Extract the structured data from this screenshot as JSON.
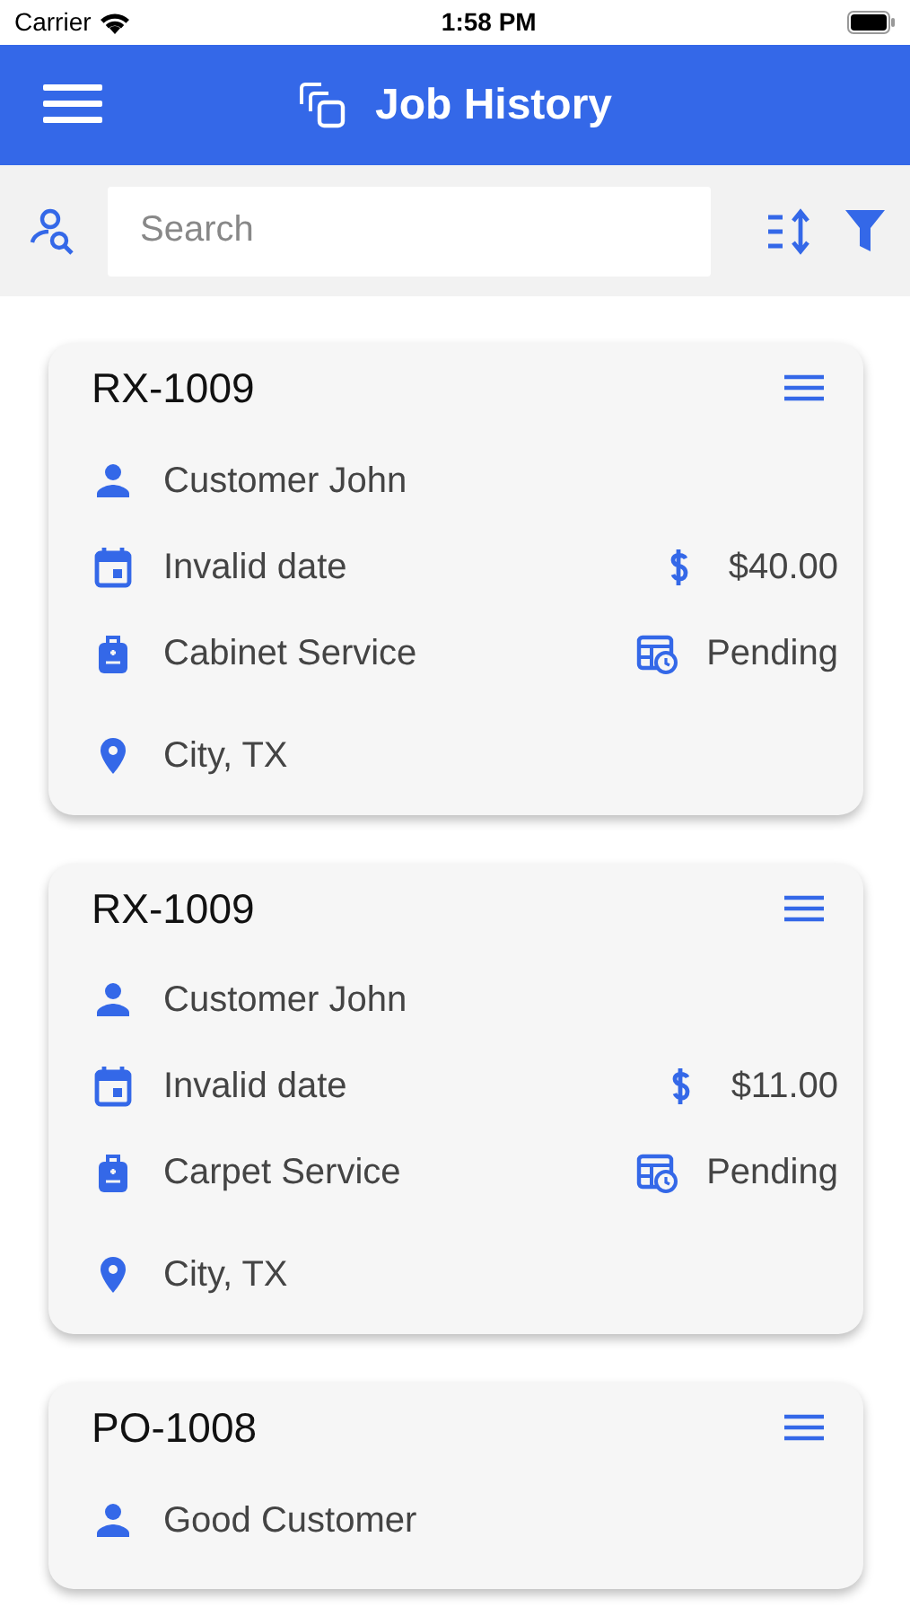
{
  "status_bar": {
    "carrier": "Carrier",
    "time": "1:58 PM"
  },
  "header": {
    "title": "Job History"
  },
  "search": {
    "placeholder": "Search"
  },
  "jobs": [
    {
      "id": "RX-1009",
      "customer": "Customer John",
      "date": "Invalid date",
      "amount": "$40.00",
      "service": "Cabinet Service",
      "status": "Pending",
      "location": "City, TX"
    },
    {
      "id": "RX-1009",
      "customer": "Customer John",
      "date": "Invalid date",
      "amount": "$11.00",
      "service": "Carpet Service",
      "status": "Pending",
      "location": "City, TX"
    },
    {
      "id": "PO-1008",
      "customer": "Good Customer"
    }
  ]
}
